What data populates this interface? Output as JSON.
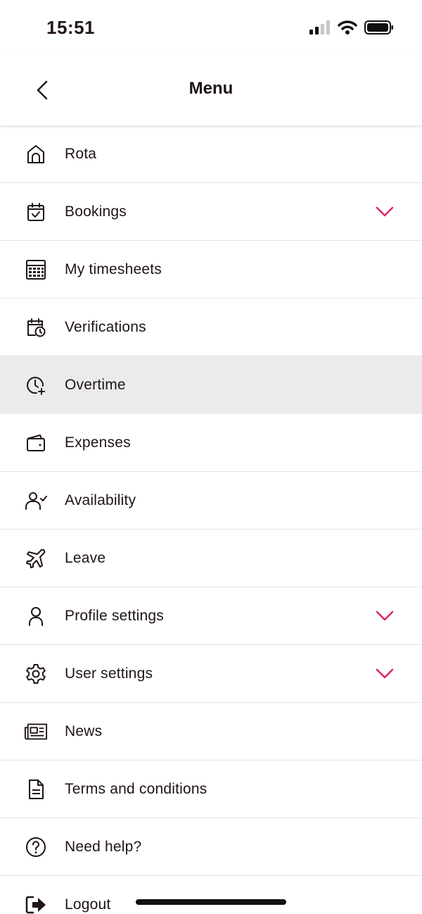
{
  "status": {
    "time": "15:51"
  },
  "header": {
    "title": "Menu"
  },
  "colors": {
    "accent": "#e0245e",
    "text": "#1f1418",
    "active_bg": "#ebebeb"
  },
  "menu": {
    "items": [
      {
        "label": "Rota",
        "icon": "home-icon",
        "expandable": false
      },
      {
        "label": "Bookings",
        "icon": "calendar-check-icon",
        "expandable": true
      },
      {
        "label": "My timesheets",
        "icon": "calculator-icon",
        "expandable": false
      },
      {
        "label": "Verifications",
        "icon": "calendar-clock-icon",
        "expandable": false
      },
      {
        "label": "Overtime",
        "icon": "clock-plus-icon",
        "expandable": false,
        "active": true
      },
      {
        "label": "Expenses",
        "icon": "wallet-icon",
        "expandable": false
      },
      {
        "label": "Availability",
        "icon": "user-check-icon",
        "expandable": false
      },
      {
        "label": "Leave",
        "icon": "airplane-icon",
        "expandable": false
      },
      {
        "label": "Profile settings",
        "icon": "user-icon",
        "expandable": true
      },
      {
        "label": "User settings",
        "icon": "gear-icon",
        "expandable": true
      },
      {
        "label": "News",
        "icon": "newspaper-icon",
        "expandable": false
      },
      {
        "label": "Terms and conditions",
        "icon": "document-icon",
        "expandable": false
      },
      {
        "label": "Need help?",
        "icon": "help-icon",
        "expandable": false
      },
      {
        "label": "Logout",
        "icon": "logout-icon",
        "expandable": false
      }
    ]
  }
}
